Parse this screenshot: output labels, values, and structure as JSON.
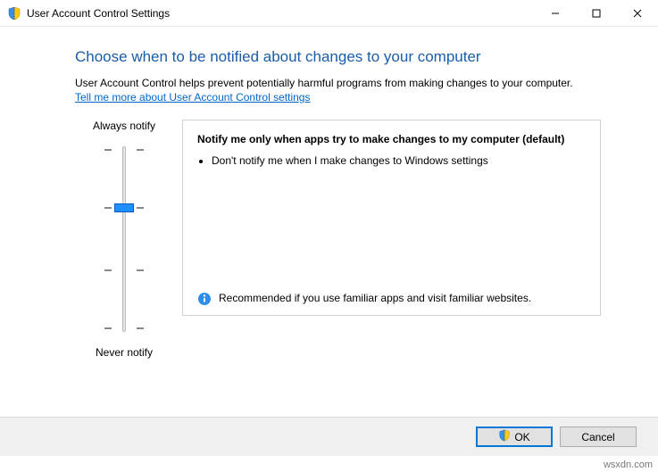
{
  "window": {
    "title": "User Account Control Settings"
  },
  "heading": "Choose when to be notified about changes to your computer",
  "description": "User Account Control helps prevent potentially harmful programs from making changes to your computer.",
  "help_link": "Tell me more about User Account Control settings",
  "slider": {
    "top_label": "Always notify",
    "bottom_label": "Never notify",
    "levels": 4,
    "selected_index_from_top": 1
  },
  "panel": {
    "title": "Notify me only when apps try to make changes to my computer (default)",
    "bullets": [
      "Don't notify me when I make changes to Windows settings"
    ],
    "recommendation": "Recommended if you use familiar apps and visit familiar websites."
  },
  "buttons": {
    "ok": "OK",
    "cancel": "Cancel"
  },
  "watermark": "wsxdn.com"
}
